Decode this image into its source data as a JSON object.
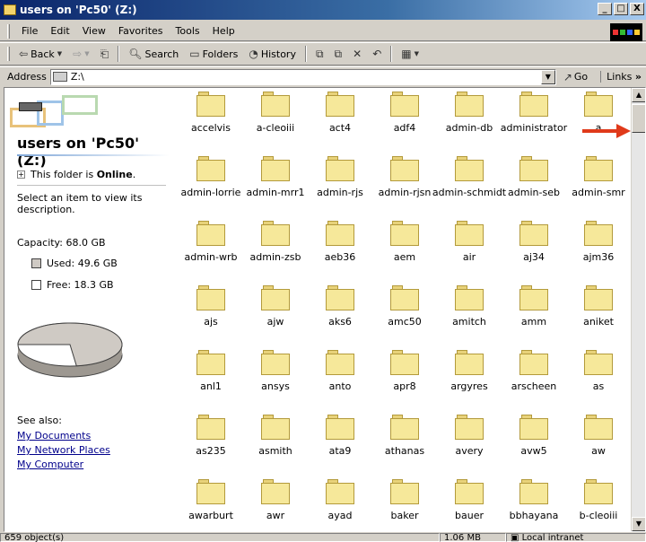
{
  "window": {
    "title": "users on 'Pc50' (Z:)",
    "buttons": [
      "_",
      "□",
      "X"
    ]
  },
  "menu": [
    "File",
    "Edit",
    "View",
    "Favorites",
    "Tools",
    "Help"
  ],
  "toolbar": {
    "back": "Back",
    "search": "Search",
    "folders": "Folders",
    "history": "History"
  },
  "address": {
    "label": "Address",
    "value": "Z:\\",
    "go": "Go",
    "links": "Links"
  },
  "leftpane": {
    "title": "users on 'Pc50' (Z:)",
    "online_prefix": "This folder is ",
    "online_value": "Online",
    "online_suffix": ".",
    "description": "Select an item to view its description.",
    "capacity": "Capacity: 68.0 GB",
    "used": "Used: 49.6 GB",
    "free": "Free: 18.3 GB",
    "used_fraction": 0.73,
    "see_also": "See also:",
    "links": [
      "My Documents",
      "My Network Places",
      "My Computer"
    ]
  },
  "folders": [
    [
      "accelvis",
      "a-cleoiii",
      "act4",
      "adf4",
      "admin-db",
      "administrator",
      "a"
    ],
    [
      "admin-lorrie",
      "admin-mrr1",
      "admin-rjs",
      "admin-rjsn",
      "admin-schmidt",
      "admin-seb",
      "admin-smr"
    ],
    [
      "admin-wrb",
      "admin-zsb",
      "aeb36",
      "aem",
      "air",
      "aj34",
      "ajm36"
    ],
    [
      "ajs",
      "ajw",
      "aks6",
      "amc50",
      "amitch",
      "amm",
      "aniket"
    ],
    [
      "anl1",
      "ansys",
      "anto",
      "apr8",
      "argyres",
      "arscheen",
      "as"
    ],
    [
      "as235",
      "asmith",
      "ata9",
      "athanas",
      "avery",
      "avw5",
      "aw"
    ],
    [
      "awarburt",
      "awr",
      "ayad",
      "baker",
      "bauer",
      "bbhayana",
      "b-cleoiii"
    ]
  ],
  "status": {
    "objects": "659 object(s)",
    "size": "1.06 MB",
    "zone": "Local intranet"
  },
  "colors": {
    "title_start": "#0a246a",
    "folder": "#f6e89a",
    "link": "#00008b",
    "arrow": "#e03a1a"
  }
}
